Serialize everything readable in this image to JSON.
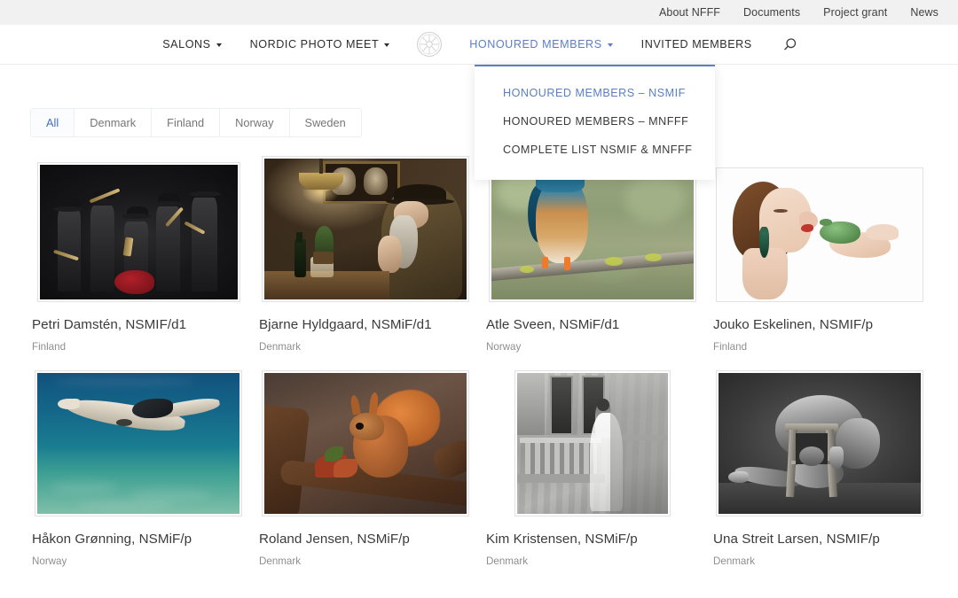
{
  "top_bar": {
    "links": [
      {
        "label": "About NFFF"
      },
      {
        "label": "Documents"
      },
      {
        "label": "Project grant"
      },
      {
        "label": "News"
      }
    ]
  },
  "main_nav": {
    "logo_icon": "wheel-logo-icon",
    "search_icon": "search-icon",
    "items": [
      {
        "label": "SALONS",
        "has_caret": true,
        "active": false
      },
      {
        "label": "NORDIC PHOTO MEET",
        "has_caret": true,
        "active": false
      },
      {
        "label": "HONOURED MEMBERS",
        "has_caret": true,
        "active": true
      },
      {
        "label": "INVITED MEMBERS",
        "has_caret": false,
        "active": false
      }
    ],
    "accent_color": "#5a7fc4"
  },
  "dropdown": {
    "open": true,
    "items": [
      {
        "label": "HONOURED MEMBERS – NSMIF",
        "active": true
      },
      {
        "label": "HONOURED MEMBERS – MNFFF",
        "active": false
      },
      {
        "label": "COMPLETE LIST NSMIF & MNFFF",
        "active": false
      }
    ]
  },
  "filters": {
    "tabs": [
      {
        "label": "All",
        "active": true
      },
      {
        "label": "Denmark",
        "active": false
      },
      {
        "label": "Finland",
        "active": false
      },
      {
        "label": "Norway",
        "active": false
      },
      {
        "label": "Sweden",
        "active": false
      }
    ],
    "active_color": "#3f6fc4"
  },
  "gallery": {
    "rows": [
      {
        "items": [
          {
            "title": "Petri Damstén, NSMIF/d1",
            "country": "Finland",
            "art": "a1",
            "alt": "dark scene with hatted figures around a figure in red"
          },
          {
            "title": "Bjarne Hyldgaard, NSMiF/d1",
            "country": "Denmark",
            "art": "a2",
            "alt": "bearded man smoking in a warm lit tavern"
          },
          {
            "title": "Atle Sveen, NSMiF/d1",
            "country": "Norway",
            "art": "a3",
            "alt": "kingfisher with fish on lichen branch"
          },
          {
            "title": "Jouko Eskelinen, NSMIF/p",
            "country": "Finland",
            "art": "a4",
            "alt": "woman kissing a green frog on her palm"
          }
        ]
      },
      {
        "items": [
          {
            "title": "Håkon Grønning, NSMiF/p",
            "country": "Norway",
            "art": "a5",
            "alt": "underwater swimmer over sandy seabed"
          },
          {
            "title": "Roland Jensen, NSMiF/p",
            "country": "Denmark",
            "art": "a6",
            "alt": "red squirrel on a weathered branch"
          },
          {
            "title": "Kim Kristensen, NSMiF/p",
            "country": "Denmark",
            "art": "a7",
            "alt": "black and white woman on an old balcony"
          },
          {
            "title": "Una Streit Larsen, NSMIF/p",
            "country": "Denmark",
            "art": "a8",
            "alt": "black and white figure study with wooden stool"
          }
        ]
      }
    ]
  }
}
